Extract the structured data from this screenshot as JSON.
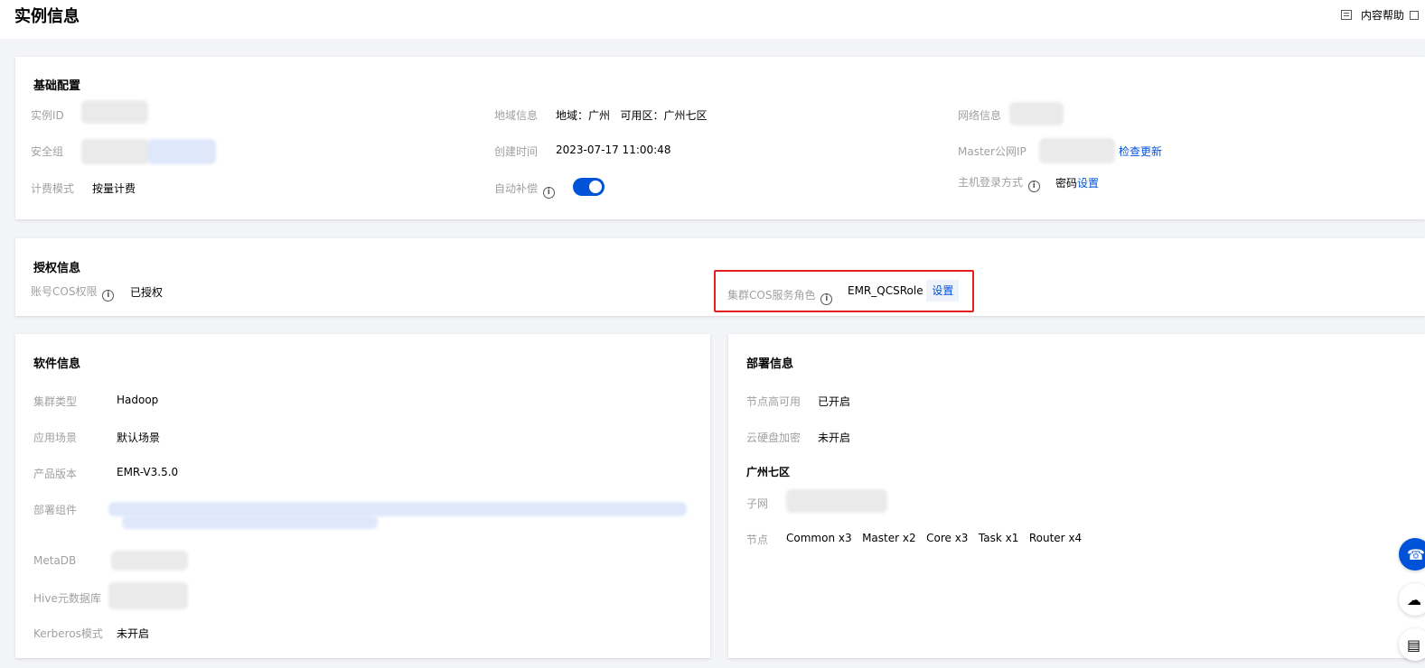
{
  "header": {
    "title": "实例信息",
    "help": "内容帮助"
  },
  "basic": {
    "title": "基础配置",
    "instance_id_label": "实例ID",
    "security_group_label": "安全组",
    "billing_label": "计费模式",
    "billing_value": "按量计费",
    "region_label": "地域信息",
    "region_value": "地域：广州   可用区：广州七区",
    "created_label": "创建时间",
    "created_value": "2023-07-17 11:00:48",
    "auto_renew_label": "自动补偿",
    "auto_renew_on": true,
    "network_label": "网络信息",
    "master_ip_label": "Master公网IP",
    "check_update": "检查更新",
    "login_label": "主机登录方式",
    "login_value": "密码",
    "login_set": "设置"
  },
  "auth": {
    "title": "授权信息",
    "cos_perm_label": "账号COS权限",
    "cos_perm_value": "已授权",
    "role_label": "集群COS服务角色",
    "role_value": "EMR_QCSRole",
    "role_set": "设置"
  },
  "software": {
    "title": "软件信息",
    "cluster_type_label": "集群类型",
    "cluster_type_value": "Hadoop",
    "scene_label": "应用场景",
    "scene_value": "默认场景",
    "version_label": "产品版本",
    "version_value": "EMR-V3.5.0",
    "components_label": "部署组件",
    "metadb_label": "MetaDB",
    "hive_label": "Hive元数据库",
    "kerberos_label": "Kerberos模式",
    "kerberos_value": "未开启"
  },
  "deploy": {
    "title": "部署信息",
    "ha_label": "节点高可用",
    "ha_value": "已开启",
    "encrypt_label": "云硬盘加密",
    "encrypt_value": "未开启",
    "zone_title": "广州七区",
    "subnet_label": "子网",
    "nodes_label": "节点",
    "nodes": [
      {
        "name": "Common",
        "count": "x3"
      },
      {
        "name": "Master",
        "count": "x2"
      },
      {
        "name": "Core",
        "count": "x3"
      },
      {
        "name": "Task",
        "count": "x1"
      },
      {
        "name": "Router",
        "count": "x4"
      }
    ]
  },
  "float_buttons": [
    "headset-icon",
    "cloud-icon",
    "book-icon"
  ],
  "colors": {
    "accent": "#0052d9",
    "highlight": "#e02020"
  }
}
